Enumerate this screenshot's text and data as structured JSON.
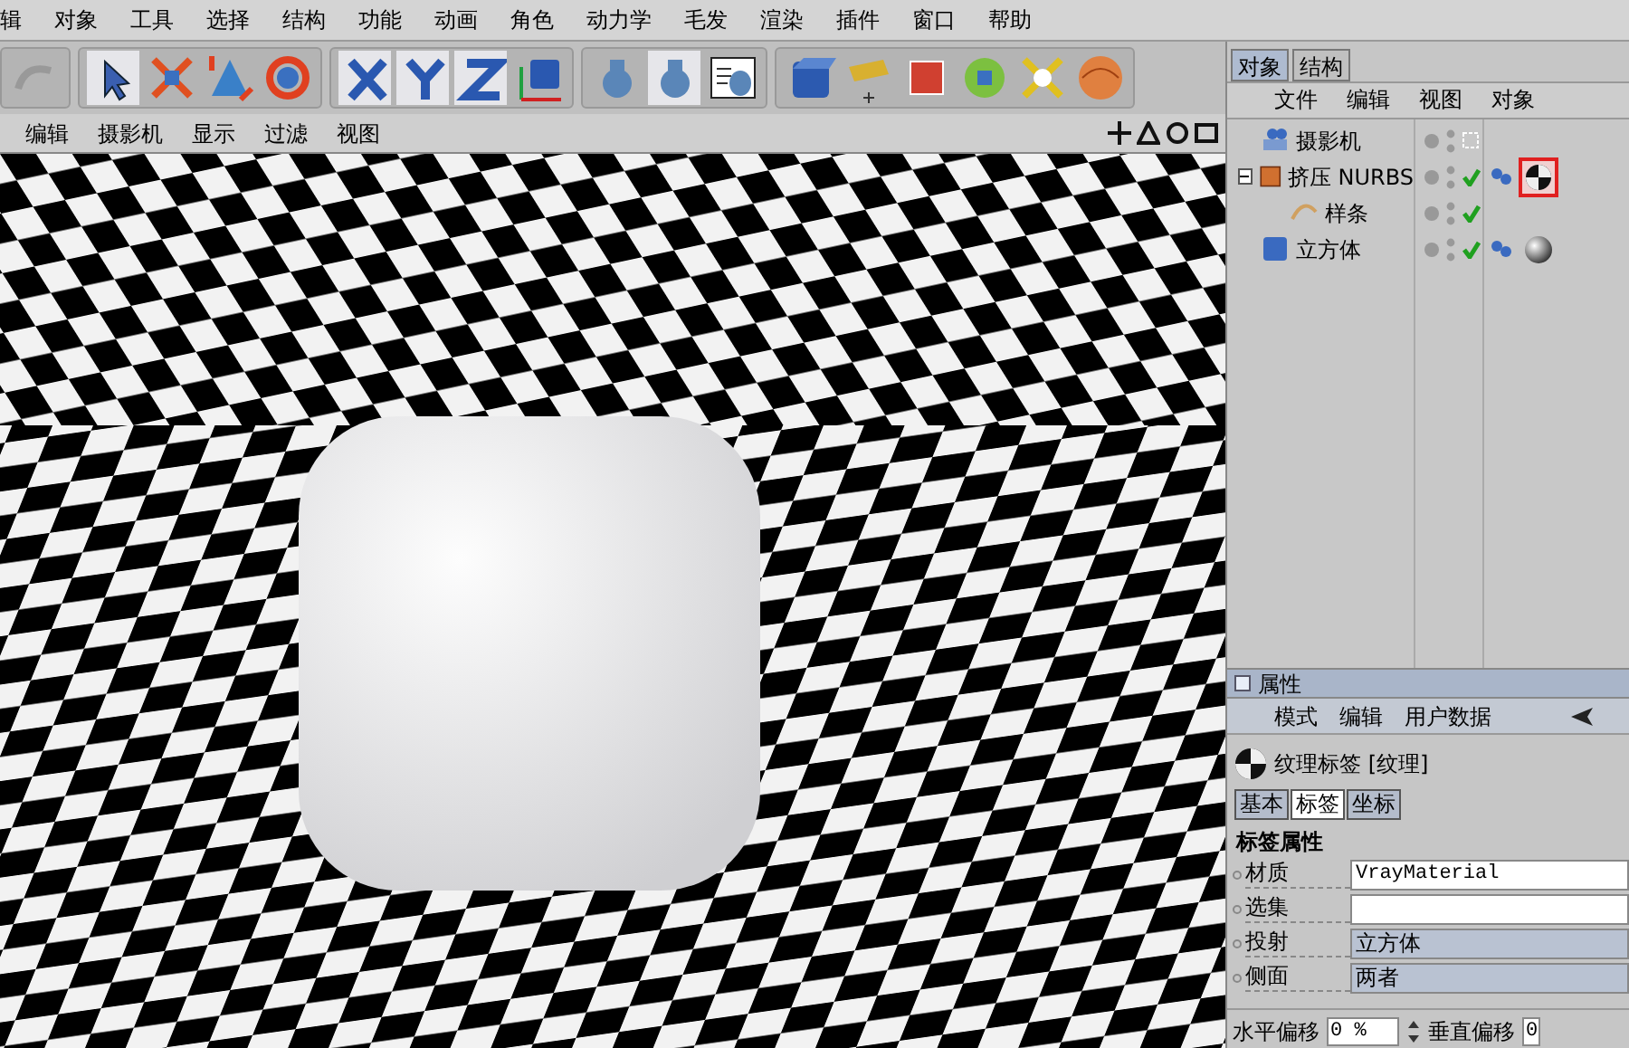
{
  "menu_bar": [
    "辑",
    "对象",
    "工具",
    "选择",
    "结构",
    "功能",
    "动画",
    "角色",
    "动力学",
    "毛发",
    "渲染",
    "插件",
    "窗口",
    "帮助"
  ],
  "toolbar": {
    "tools": [
      {
        "kind": "undo",
        "selected": false
      },
      {
        "kind": "pointer",
        "selected": true
      },
      {
        "kind": "move",
        "selected": false
      },
      {
        "kind": "scale",
        "selected": false
      },
      {
        "kind": "rotate",
        "selected": false
      },
      {
        "kind": "x",
        "selected": true
      },
      {
        "kind": "y",
        "selected": true
      },
      {
        "kind": "z",
        "selected": true
      },
      {
        "kind": "coords",
        "selected": false
      },
      {
        "kind": "render",
        "selected": false
      },
      {
        "kind": "render",
        "selected": true
      },
      {
        "kind": "render-settings",
        "selected": false
      },
      {
        "kind": "cube",
        "selected": false
      },
      {
        "kind": "spline",
        "selected": false
      },
      {
        "kind": "deformer",
        "selected": false
      },
      {
        "kind": "array",
        "selected": false
      },
      {
        "kind": "light",
        "selected": false
      },
      {
        "kind": "sphere",
        "selected": false
      }
    ]
  },
  "viewport": {
    "menu": [
      "编辑",
      "摄影机",
      "显示",
      "过滤",
      "视图"
    ]
  },
  "object_manager": {
    "tabs": [
      {
        "label": "对象",
        "selected": true
      },
      {
        "label": "结构",
        "selected": false
      }
    ],
    "menu": [
      "文件",
      "编辑",
      "视图",
      "对象"
    ],
    "objects": [
      {
        "name": "摄影机",
        "kind": "camera",
        "checked": false
      },
      {
        "name": "挤压 NURBS",
        "kind": "extrude",
        "checked": true,
        "expanded": true,
        "tags": [
          {
            "kind": "texture",
            "selected": true
          }
        ],
        "children": [
          {
            "name": "样条",
            "kind": "spline",
            "checked": true
          }
        ]
      },
      {
        "name": "立方体",
        "kind": "cube",
        "checked": true,
        "tags": [
          {
            "kind": "material",
            "selected": false
          }
        ]
      }
    ]
  },
  "attributes": {
    "title": "属性",
    "menu": [
      "模式",
      "编辑",
      "用户数据"
    ],
    "header": "纹理标签 [纹理]",
    "tabs": [
      {
        "label": "基本",
        "selected": false
      },
      {
        "label": "标签",
        "selected": true
      },
      {
        "label": "坐标",
        "selected": false
      }
    ],
    "section": "标签属性",
    "fields": [
      {
        "label": "材质",
        "kind": "text",
        "value": "VrayMaterial"
      },
      {
        "label": "选集",
        "kind": "text"
      },
      {
        "label": "投射",
        "kind": "dropdown",
        "value": "立方体"
      },
      {
        "label": "侧面",
        "kind": "dropdown",
        "value": "两者"
      }
    ],
    "offsets": [
      {
        "label": "水平偏移",
        "value": "0 %"
      },
      {
        "label": "垂直偏移",
        "value": "0"
      }
    ]
  }
}
